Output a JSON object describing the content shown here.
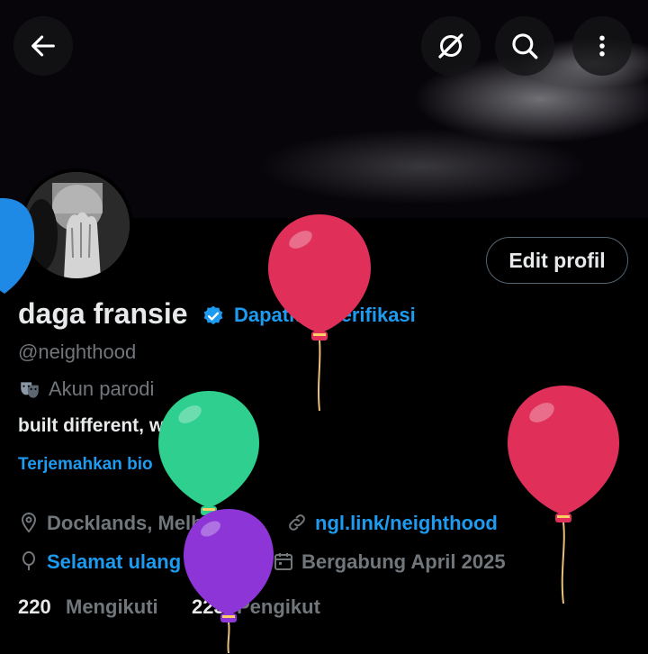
{
  "header": {
    "back_icon": "arrow-left-icon",
    "grok_icon": "grok-slash-icon",
    "search_icon": "search-icon",
    "more_icon": "more-vertical-icon"
  },
  "profile": {
    "name": "daga fransie",
    "get_verified": "Dapatkan Verifikasi",
    "handle": "@neighthood",
    "parody_label": "Akun parodi",
    "bio": "built different, wired weird.",
    "translate_bio": "Terjemahkan bio",
    "location": "Docklands, Melbourne",
    "website": "ngl.link/neighthood",
    "birthday": "Selamat ulang tahun!",
    "joined": "Bergabung April 2025",
    "following_count": "220",
    "following_label": "Mengikuti",
    "followers_count": "223",
    "followers_label": "Pengikut",
    "edit_button": "Edit profil"
  },
  "colors": {
    "accent": "#1d9bf0",
    "muted": "#71767b",
    "text": "#e7e9ea",
    "balloon_red": "#e0305a",
    "balloon_green": "#2ecf8f",
    "balloon_purple": "#8d35d6",
    "balloon_blue": "#1f8ae6"
  }
}
